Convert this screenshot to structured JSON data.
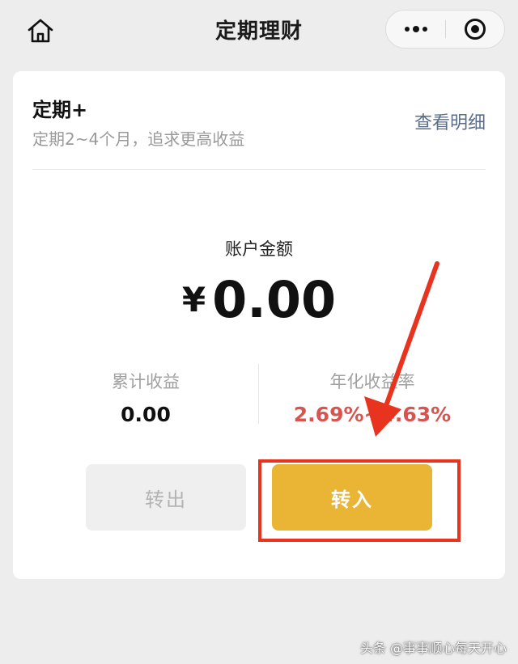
{
  "nav": {
    "title": "定期理财",
    "home_icon": "home-icon",
    "more_icon": "more-dots-icon",
    "close_icon": "target-close-icon"
  },
  "product": {
    "title": "定期+",
    "description": "定期2~4个月，追求更高收益",
    "detail_link": "查看明细"
  },
  "account": {
    "label": "账户金额",
    "currency": "¥",
    "amount": "0.00"
  },
  "stats": {
    "cumulative_label": "累计收益",
    "cumulative_value": "0.00",
    "annual_label": "年化收益率",
    "annual_value": "2.69%~4.63%"
  },
  "buttons": {
    "transfer_out": "转出",
    "transfer_in": "转入"
  },
  "colors": {
    "accent": "#eab435",
    "rate": "#d9534f",
    "annotation": "#e8341f",
    "link": "#5a6c8a"
  },
  "watermark": "头条 @事事顺心每天开心"
}
